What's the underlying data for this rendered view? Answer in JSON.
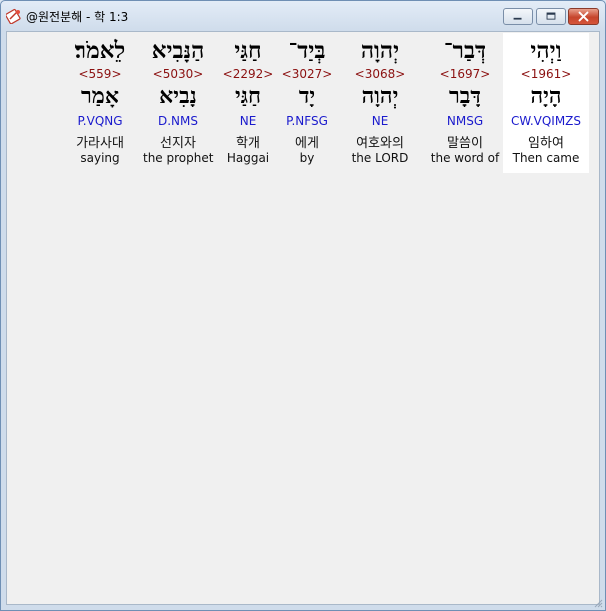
{
  "window": {
    "title": "@원전분해 - 학 1:3",
    "icon": "app-icon",
    "controls": {
      "minimize": "minimize-icon",
      "maximize": "maximize-icon",
      "close": "close-icon"
    }
  },
  "words": [
    {
      "surface": "וַיְהִי",
      "strong": "<1961>",
      "lemma": "הָיָה",
      "parse": "CW.VQIMZS",
      "korean": "임하여",
      "english": "Then came",
      "selected": true
    },
    {
      "surface": "דְּבַר־",
      "strong": "<1697>",
      "lemma": "דָּבָר",
      "parse": "NMSG",
      "korean": "말씀이",
      "english": "the word of",
      "selected": false
    },
    {
      "surface": "יְהוָה",
      "strong": "<3068>",
      "lemma": "יְהוָה",
      "parse": "NE",
      "korean": "여호와의",
      "english": "the LORD",
      "selected": false
    },
    {
      "surface": "בְּיַד־",
      "strong": "<3027>",
      "lemma": "יָד",
      "parse": "P.NFSG",
      "korean": "에게",
      "english": "by",
      "selected": false
    },
    {
      "surface": "חַגַּי",
      "strong": "<2292>",
      "lemma": "חַגַּי",
      "parse": "NE",
      "korean": "학개",
      "english": "Haggai",
      "selected": false
    },
    {
      "surface": "הַנָּבִיא",
      "strong": "<5030>",
      "lemma": "נָבִיא",
      "parse": "D.NMS",
      "korean": "선지자",
      "english": "the prophet",
      "selected": false
    },
    {
      "surface": "לֵאמֹר׃",
      "strong": "<559>",
      "lemma": "אָמַר",
      "parse": "P.VQNG",
      "korean": "가라사대",
      "english": "saying",
      "selected": false
    }
  ]
}
